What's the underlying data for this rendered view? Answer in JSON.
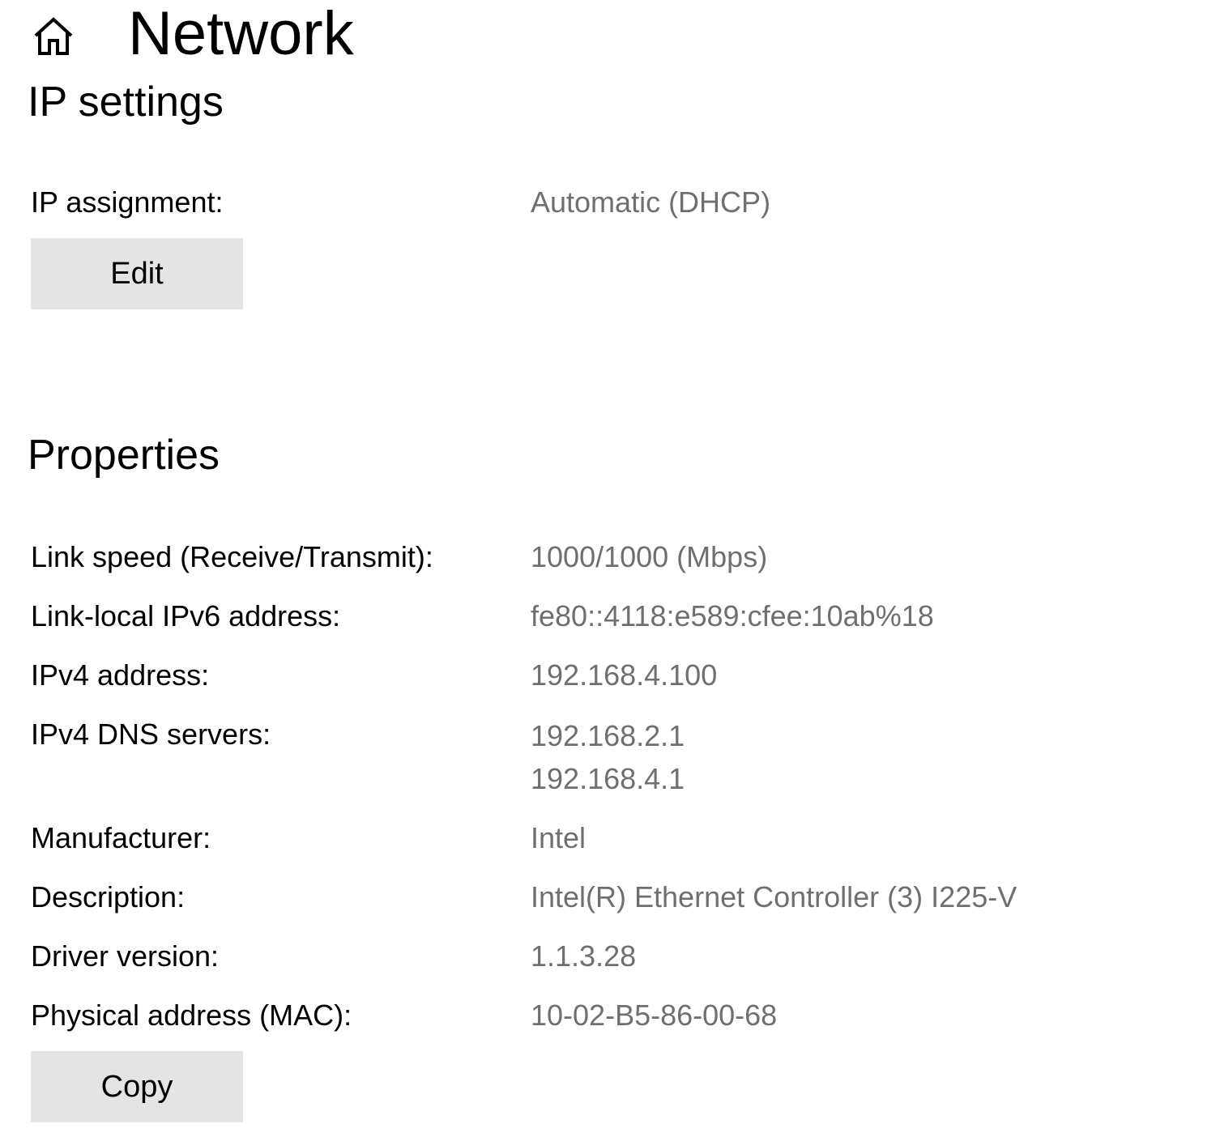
{
  "header": {
    "icon": "home-icon",
    "title": "Network"
  },
  "ip_settings": {
    "title": "IP settings",
    "assignment_label": "IP assignment:",
    "assignment_value": "Automatic (DHCP)",
    "edit_label": "Edit"
  },
  "properties": {
    "title": "Properties",
    "rows": [
      {
        "label": "Link speed (Receive/Transmit):",
        "value": "1000/1000 (Mbps)"
      },
      {
        "label": "Link-local IPv6 address:",
        "value": "fe80::4118:e589:cfee:10ab%18"
      },
      {
        "label": "IPv4 address:",
        "value": "192.168.4.100"
      },
      {
        "label": "IPv4 DNS servers:",
        "value": "192.168.2.1",
        "value2": "192.168.4.1"
      },
      {
        "label": "Manufacturer:",
        "value": "Intel"
      },
      {
        "label": "Description:",
        "value": "Intel(R) Ethernet Controller (3) I225-V"
      },
      {
        "label": "Driver version:",
        "value": "1.1.3.28"
      },
      {
        "label": "Physical address (MAC):",
        "value": "10-02-B5-86-00-68"
      }
    ],
    "copy_label": "Copy"
  },
  "colors": {
    "value_text": "#6f6f6f",
    "button_bg": "#e4e4e4"
  }
}
